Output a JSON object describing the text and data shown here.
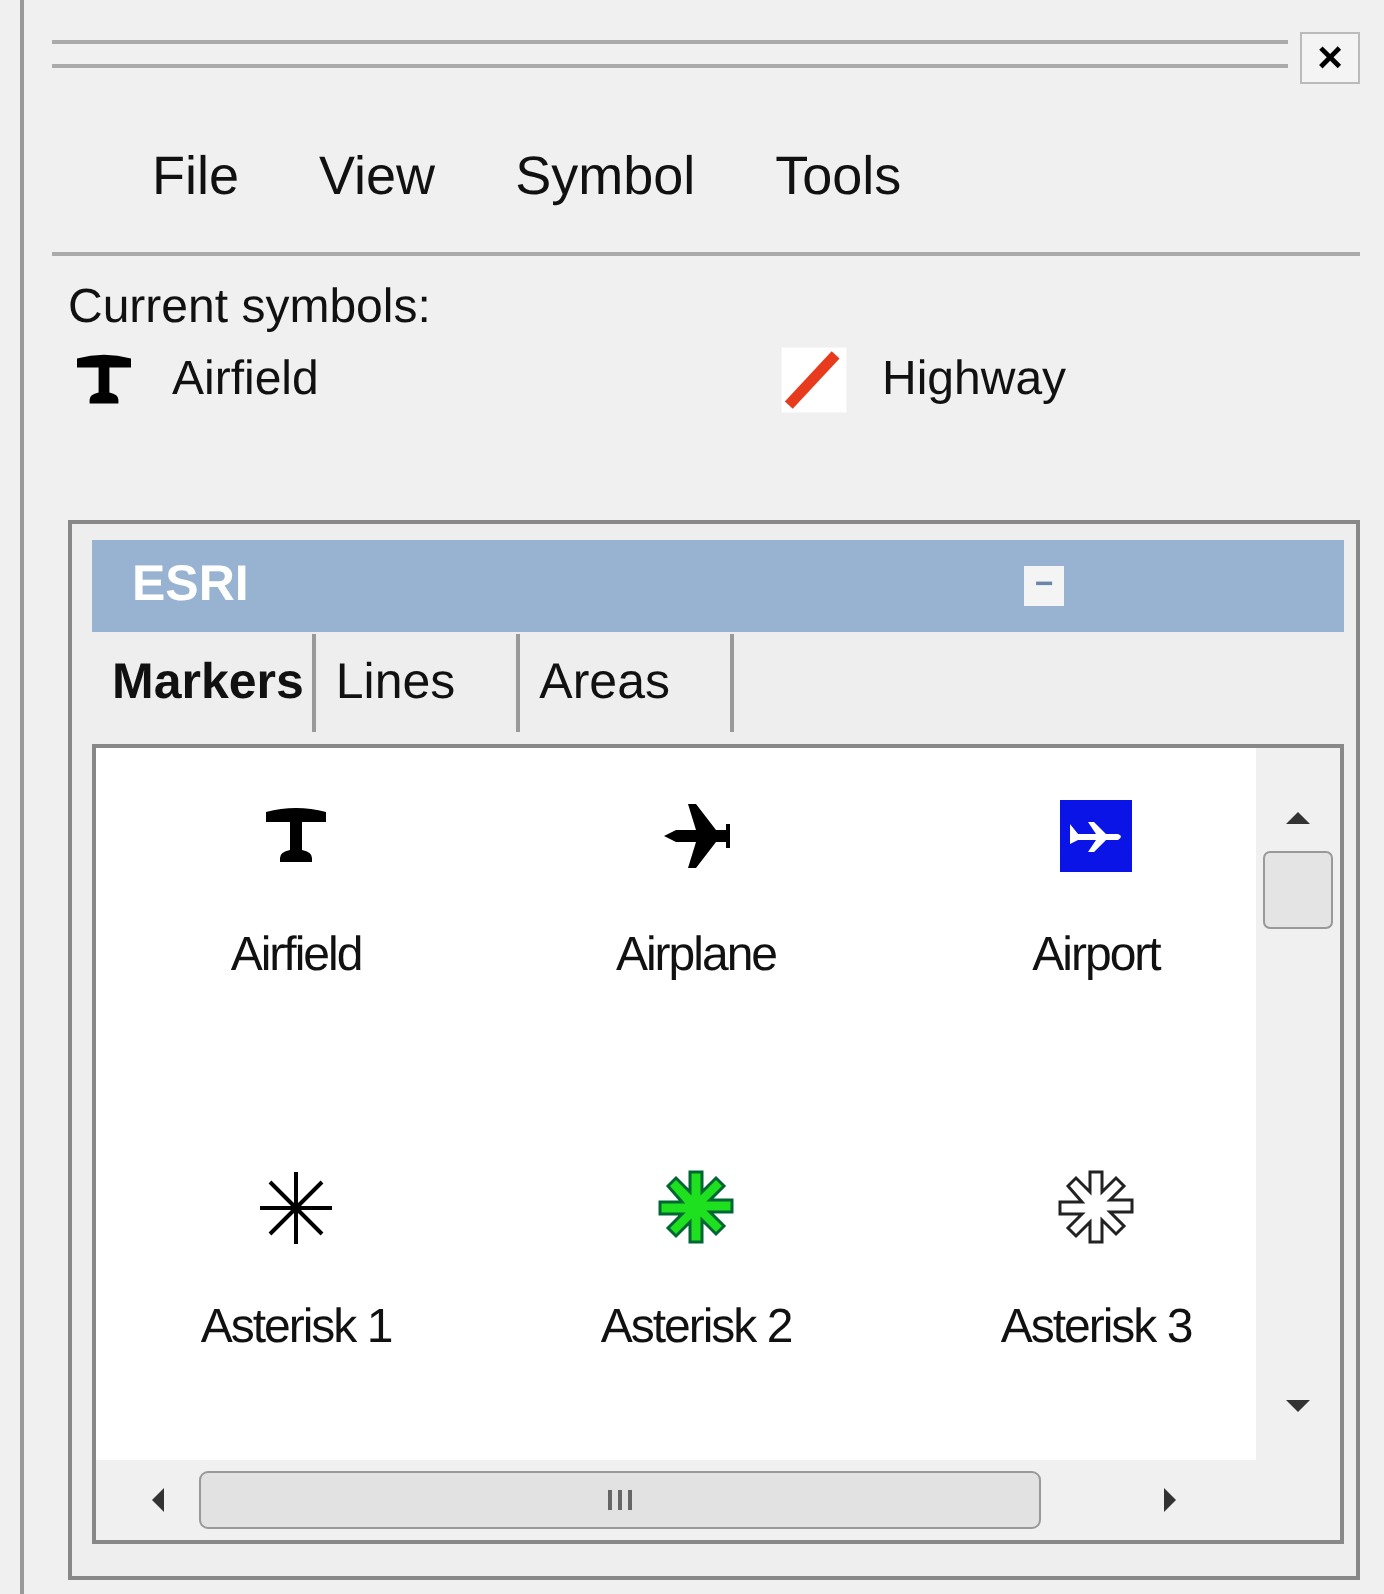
{
  "window": {
    "close": "×"
  },
  "menu": [
    "File",
    "View",
    "Symbol",
    "Tools"
  ],
  "current_symbols": {
    "label": "Current symbols:",
    "items": [
      {
        "kind": "airfield",
        "name": "Airfield"
      },
      {
        "kind": "highway",
        "name": "Highway"
      }
    ]
  },
  "panel": {
    "title": "ESRI",
    "collapse": "−",
    "tabs": [
      {
        "label": "Markers",
        "selected": true
      },
      {
        "label": "Lines",
        "selected": false
      },
      {
        "label": "Areas",
        "selected": false
      }
    ],
    "symbols": [
      {
        "kind": "airfield",
        "name": "Airfield"
      },
      {
        "kind": "airplane",
        "name": "Airplane"
      },
      {
        "kind": "airport",
        "name": "Airport"
      },
      {
        "kind": "asterisk1",
        "name": "Asterisk 1"
      },
      {
        "kind": "asterisk2",
        "name": "Asterisk 2"
      },
      {
        "kind": "asterisk3",
        "name": "Asterisk 3"
      }
    ]
  }
}
